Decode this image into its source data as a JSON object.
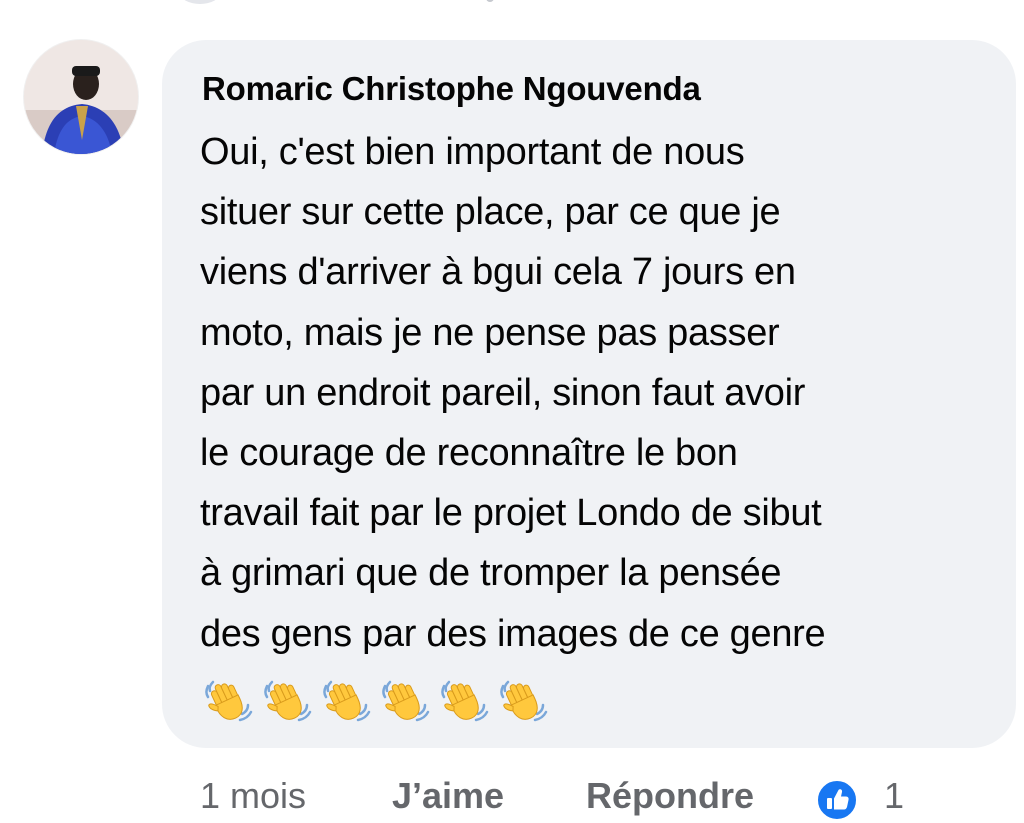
{
  "comment": {
    "author": "Romaric Christophe Ngouvenda",
    "text_lines": [
      "Oui, c'est bien important de nous",
      "situer sur cette place, par ce que je",
      "viens d'arriver à bgui cela 7 jours en",
      "moto, mais je ne pense pas passer",
      "par un endroit pareil, sinon faut avoir",
      "le courage de reconnaître le bon",
      "travail fait par le projet Londo de sibut",
      "à grimari que de tromper la pensée",
      "des gens par des  images de ce genre"
    ],
    "emojis": [
      "👋",
      "👋",
      "👋",
      "👋",
      "👋",
      "👋"
    ]
  },
  "actions": {
    "time": "1 mois",
    "like_label": "J’aime",
    "reply_label": "Répondre",
    "reaction_icon": "thumbs-up-icon",
    "reaction_count": "1"
  },
  "colors": {
    "bubble_bg": "#f0f2f5",
    "text": "#050505",
    "meta_text": "#65676b",
    "like_blue": "#1877f2",
    "emoji_yellow": "#ffc83d"
  }
}
